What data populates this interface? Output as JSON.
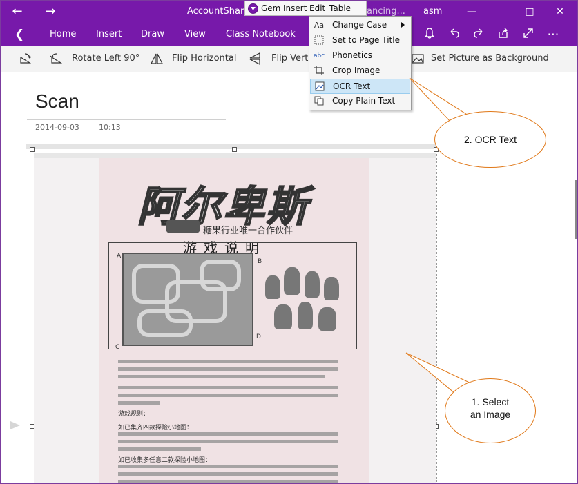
{
  "titlebar": {
    "title": "AccountShare",
    "title_tail": "ancing...",
    "user": "asm"
  },
  "gem_toolbar": {
    "items": [
      "Gem",
      "Insert",
      "Edit",
      "Table"
    ]
  },
  "ribbon": {
    "tabs": [
      "Home",
      "Insert",
      "Draw",
      "View",
      "Class Notebook"
    ]
  },
  "picture_toolbar": {
    "rotate_left": "Rotate Left 90°",
    "flip_horizontal": "Flip Horizontal",
    "flip_vertical": "Flip Vertic",
    "set_background": "Set Picture as Background"
  },
  "page": {
    "title": "Scan",
    "date": "2014-09-03",
    "time": "10:13"
  },
  "context_menu": {
    "items": [
      {
        "label": "Change Case",
        "icon": "Aa",
        "submenu": true
      },
      {
        "label": "Set to Page Title",
        "icon": "",
        "submenu": false
      },
      {
        "label": "Phonetics",
        "icon": "abc",
        "submenu": false
      },
      {
        "label": "Crop Image",
        "icon": "",
        "submenu": false
      },
      {
        "label": "OCR Text",
        "icon": "",
        "submenu": false,
        "selected": true
      },
      {
        "label": "Copy Plain Text",
        "icon": "",
        "submenu": false
      }
    ]
  },
  "scan": {
    "heading": "阿尔卑斯",
    "subheading": "糖果行业唯一合作伙伴",
    "game_title": "游戏说明",
    "labels": [
      "A",
      "B",
      "C",
      "D"
    ],
    "section_1": "游戏规则：",
    "section_2": "如已集齐四款探险小地图：",
    "section_3": "如已收集多任意二款探险小地图："
  },
  "callouts": {
    "ocr": "2.  OCR Text",
    "select_line1": "1.  Select",
    "select_line2": "an Image"
  }
}
